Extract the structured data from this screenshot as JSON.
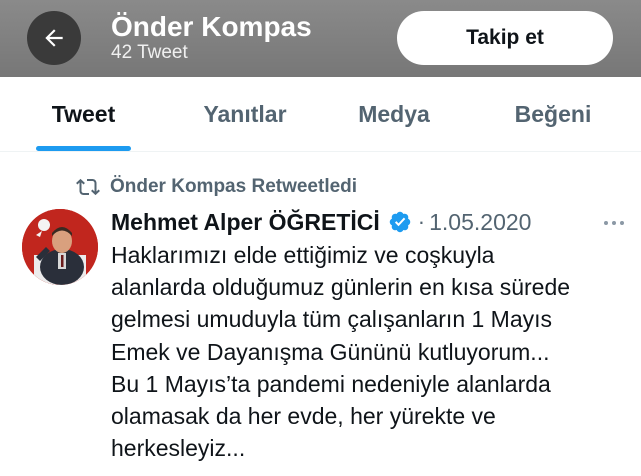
{
  "header": {
    "profile_name": "Önder Kompas",
    "tweet_count": "42 Tweet",
    "follow_label": "Takip et",
    "back_icon": "arrow-left-icon"
  },
  "tabs": [
    {
      "label": "Tweet",
      "active": true
    },
    {
      "label": "Yanıtlar",
      "active": false
    },
    {
      "label": "Medya",
      "active": false
    },
    {
      "label": "Beğeni",
      "active": false
    }
  ],
  "tweet": {
    "retweet_label": "Önder Kompas Retweetledi",
    "author_name": "Mehmet Alper ÖĞRETİCİ",
    "verified": true,
    "separator": "·",
    "date": "1.05.2020",
    "text_lines": [
      "Haklarımızı elde ettiğimiz ve coşkuyla",
      "alanlarda olduğumuz günlerin en kısa sürede",
      "gelmesi umuduyla tüm çalışanların 1 Mayıs",
      "Emek ve Dayanışma Gününü kutluyorum...",
      "Bu 1 Mayıs’ta pandemi nedeniyle alanlarda",
      "olamasak da her evde, her yürekte ve",
      "herkesleyiz..."
    ]
  },
  "colors": {
    "accent": "#1d9bf0",
    "secondary_text": "#536471",
    "header_bg": "#808080"
  }
}
